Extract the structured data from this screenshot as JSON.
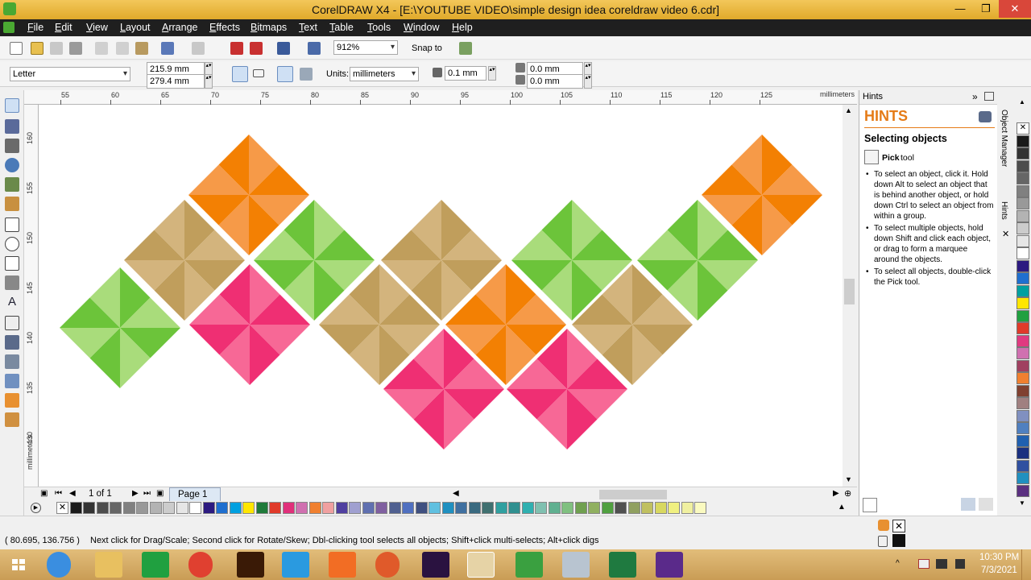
{
  "window": {
    "title": "CorelDRAW X4 - [E:\\YOUTUBE VIDEO\\simple design idea coreldraw video 6.cdr]",
    "controls": {
      "minimize": "—",
      "restore": "❐",
      "close": "✕"
    }
  },
  "menu": [
    "File",
    "Edit",
    "View",
    "Layout",
    "Arrange",
    "Effects",
    "Bitmaps",
    "Text",
    "Table",
    "Tools",
    "Window",
    "Help"
  ],
  "standard_toolbar": {
    "zoom": "912%",
    "snap_to": "Snap to"
  },
  "property_bar": {
    "paper_size": "Letter",
    "width": "215.9 mm",
    "height": "279.4 mm",
    "units_label": "Units:",
    "units": "millimeters",
    "nudge": "0.1 mm",
    "dup_x": "0.0 mm",
    "dup_y": "0.0 mm"
  },
  "rulers": {
    "h_labels": [
      "55",
      "60",
      "65",
      "70",
      "75",
      "80",
      "85",
      "90",
      "95",
      "100",
      "105",
      "110",
      "115",
      "120",
      "125"
    ],
    "h_unit": "millimeters",
    "v_labels": [
      "160",
      "155",
      "150",
      "145",
      "140",
      "135",
      "130"
    ],
    "v_unit": "millimeters"
  },
  "page_nav": {
    "counter": "1 of 1",
    "tab": "Page 1"
  },
  "docker": {
    "header": "Hints",
    "title": "HINTS",
    "subtitle": "Selecting objects",
    "tool_name": "Pick",
    "tool_suffix": "tool",
    "hints": [
      "To select an object, click it. Hold down Alt to select an object that is behind another object, or hold down Ctrl to select an object from within a group.",
      "To select multiple objects, hold down Shift and click each object, or drag to form a marquee around the objects.",
      "To select all objects, double-click the Pick tool."
    ],
    "side_tabs": [
      "Object Manager",
      "Hints"
    ]
  },
  "status": {
    "coords": "( 80.695, 136.756 )",
    "message": "Next click for Drag/Scale; Second click for Rotate/Skew; Dbl-clicking tool selects all objects; Shift+click multi-selects; Alt+click digs"
  },
  "taskbar": {
    "time": "10:30 PM",
    "date": "7/3/2021"
  },
  "colors": {
    "orange_dark": "#f38003",
    "orange_light": "#f69a48",
    "green_dark": "#6cc43a",
    "green_light": "#a9dc7b",
    "tan_dark": "#c09e5c",
    "tan_light": "#d3b47d",
    "pink_dark": "#ef2f73",
    "pink_light": "#f76896"
  },
  "design_tiles": [
    {
      "color": "orange",
      "flip": false
    },
    {
      "color": "tan",
      "flip": true
    },
    {
      "color": "green",
      "flip": true
    },
    {
      "color": "green",
      "flip": false
    },
    {
      "color": "pink",
      "flip": false
    },
    {
      "color": "tan",
      "flip": true
    },
    {
      "color": "tan",
      "flip": false
    },
    {
      "color": "orange",
      "flip": true
    },
    {
      "color": "green",
      "flip": false
    },
    {
      "color": "pink",
      "flip": true
    },
    {
      "color": "pink",
      "flip": false
    },
    {
      "color": "tan",
      "flip": true
    },
    {
      "color": "green",
      "flip": false
    },
    {
      "color": "orange",
      "flip": true
    }
  ]
}
